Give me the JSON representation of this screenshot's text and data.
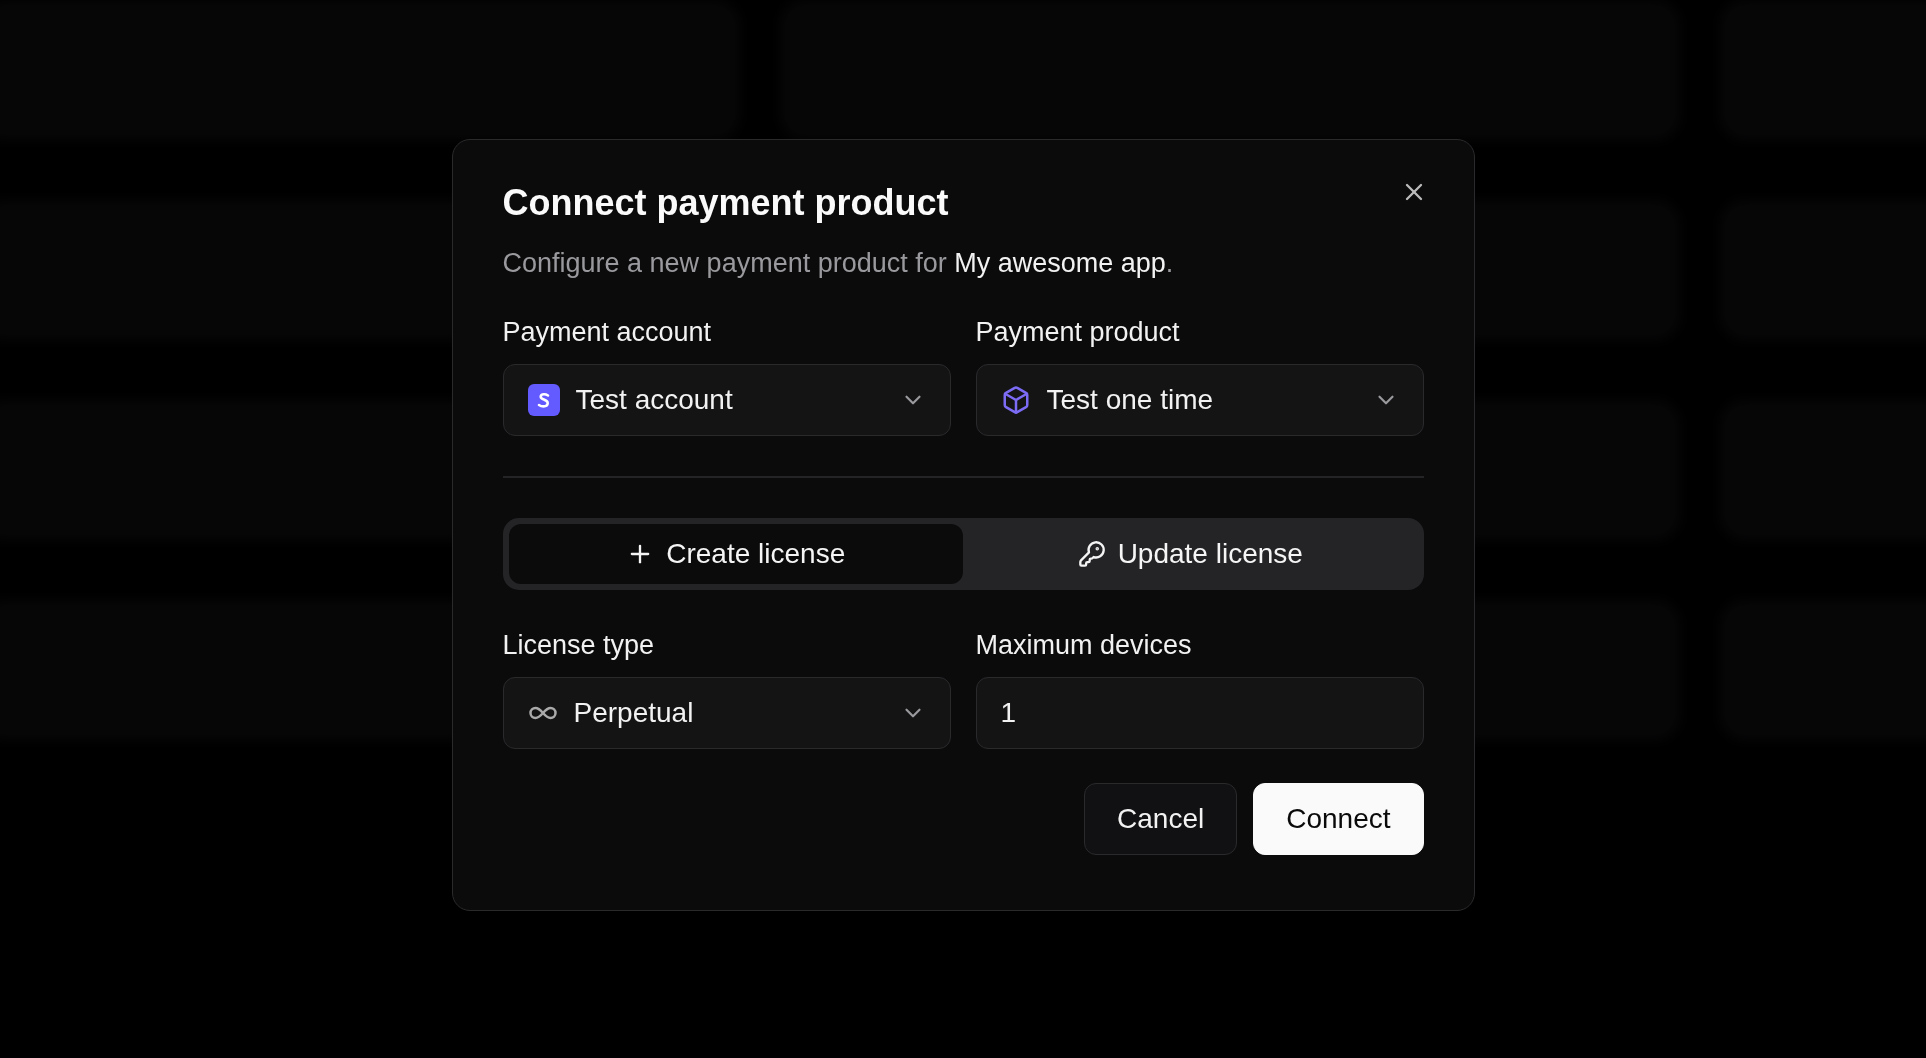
{
  "dialog": {
    "title": "Connect payment product",
    "description": {
      "text": "Configure a new payment product for ",
      "emphasis": "My awesome app",
      "end": "."
    },
    "payment_account": {
      "label": "Payment account",
      "value": "Test account"
    },
    "payment_product": {
      "label": "Payment product",
      "value": "Test one time"
    },
    "tabs": [
      {
        "label": "Create license",
        "selected": true
      },
      {
        "label": "Update license",
        "selected": false
      }
    ],
    "license_type": {
      "label": "License type",
      "value": "Perpetual"
    },
    "maximum_devices": {
      "label": "Maximum devices",
      "value": "1"
    },
    "buttons": [
      {
        "label": "Cancel",
        "kind": "secondary"
      },
      {
        "label": "Connect",
        "kind": "primary"
      }
    ]
  }
}
